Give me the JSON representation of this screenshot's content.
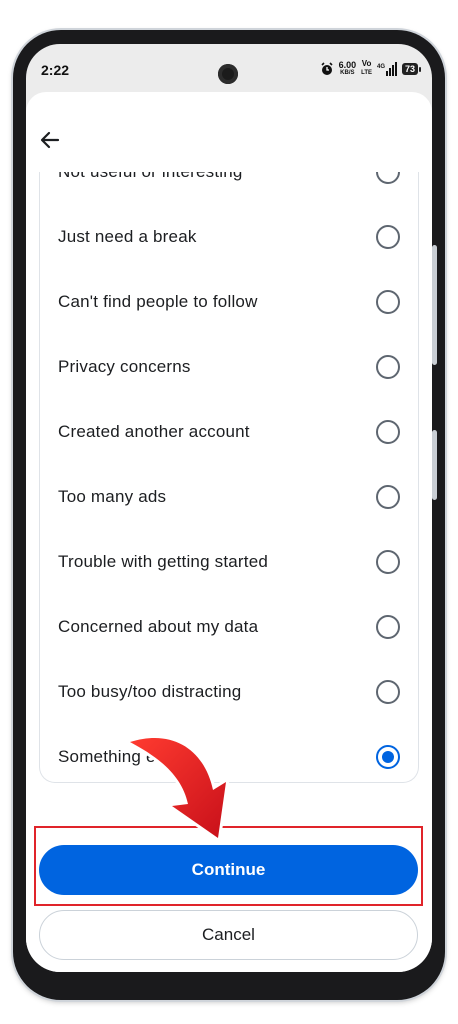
{
  "status_bar": {
    "time": "2:22",
    "net_speed": "6.00",
    "net_unit": "KB/S",
    "volte_top": "Vo",
    "volte_bottom": "LTE",
    "network": "4G",
    "battery": "73"
  },
  "options": {
    "partial_item": "Not useful or interesting",
    "items": [
      {
        "label": "Just need a break",
        "selected": false
      },
      {
        "label": "Can't find people to follow",
        "selected": false
      },
      {
        "label": "Privacy concerns",
        "selected": false
      },
      {
        "label": "Created another account",
        "selected": false
      },
      {
        "label": "Too many ads",
        "selected": false
      },
      {
        "label": "Trouble with getting started",
        "selected": false
      },
      {
        "label": "Concerned about my data",
        "selected": false
      },
      {
        "label": "Too busy/too distracting",
        "selected": false
      },
      {
        "label": "Something else",
        "selected": true
      }
    ]
  },
  "actions": {
    "continue_label": "Continue",
    "cancel_label": "Cancel"
  },
  "colors": {
    "accent": "#0064e0",
    "annotation_red": "#e0242a"
  }
}
